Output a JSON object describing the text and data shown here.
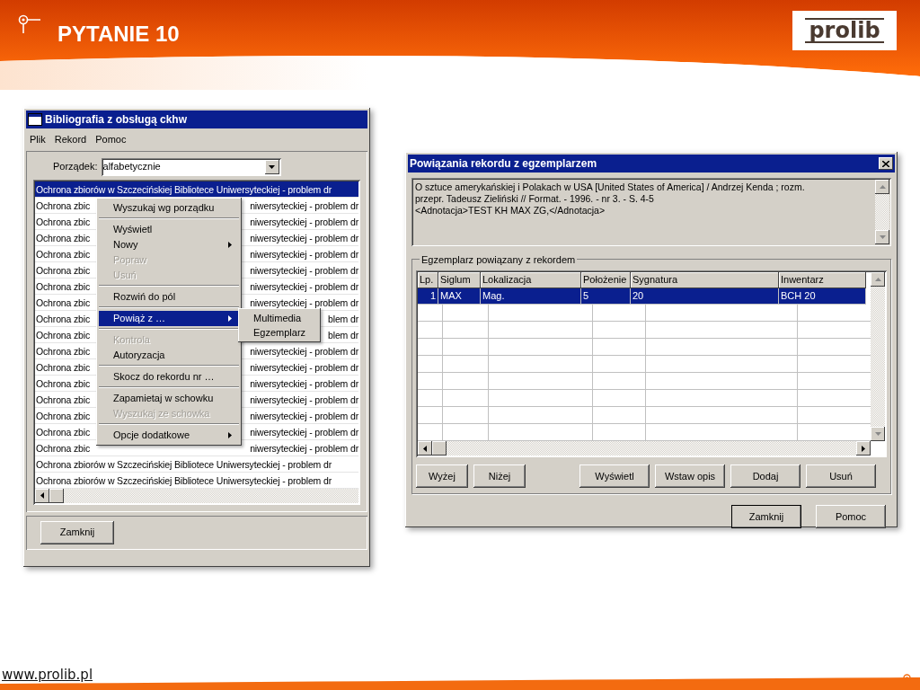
{
  "slide": {
    "title": "PYTANIE 10",
    "logo": "prolib",
    "footer_link": "www.prolib.pl"
  },
  "main_window": {
    "title": "Bibliografia z obsługą ckhw",
    "menu": [
      "Plik",
      "Rekord",
      "Pomoc"
    ],
    "order_label": "Porządek:",
    "order_value": "alfabetycznie",
    "close_button": "Zamknij",
    "rows": [
      {
        "kind": "full",
        "text": "Ochrona zbiorów w Szczecińskiej Bibliotece Uniwersyteckiej - problem dr",
        "selected": true
      },
      {
        "kind": "covered",
        "left": "Ochrona zbic",
        "right": "niwersyteckiej - problem dr",
        "selected": false
      },
      {
        "kind": "covered",
        "left": "Ochrona zbic",
        "right": "niwersyteckiej - problem dr",
        "selected": false
      },
      {
        "kind": "covered",
        "left": "Ochrona zbic",
        "right": "niwersyteckiej - problem dr",
        "selected": false
      },
      {
        "kind": "covered",
        "left": "Ochrona zbic",
        "right": "niwersyteckiej - problem dr",
        "selected": false
      },
      {
        "kind": "covered",
        "left": "Ochrona zbic",
        "right": "niwersyteckiej - problem dr",
        "selected": false
      },
      {
        "kind": "covered",
        "left": "Ochrona zbic",
        "right": "niwersyteckiej - problem dr",
        "selected": false
      },
      {
        "kind": "covered",
        "left": "Ochrona zbic",
        "right": "niwersyteckiej - problem dr",
        "selected": false
      },
      {
        "kind": "covered",
        "left": "Ochrona zbic",
        "right": "blem dr",
        "selected": false
      },
      {
        "kind": "covered",
        "left": "Ochrona zbic",
        "right": "blem dr",
        "selected": false
      },
      {
        "kind": "covered",
        "left": "Ochrona zbic",
        "right": "niwersyteckiej - problem dr",
        "selected": false
      },
      {
        "kind": "covered",
        "left": "Ochrona zbic",
        "right": "niwersyteckiej - problem dr",
        "selected": false
      },
      {
        "kind": "covered",
        "left": "Ochrona zbic",
        "right": "niwersyteckiej - problem dr",
        "selected": false
      },
      {
        "kind": "covered",
        "left": "Ochrona zbic",
        "right": "niwersyteckiej - problem dr",
        "selected": false
      },
      {
        "kind": "covered",
        "left": "Ochrona zbic",
        "right": "niwersyteckiej - problem dr",
        "selected": false
      },
      {
        "kind": "covered",
        "left": "Ochrona zbic",
        "right": "niwersyteckiej - problem dr",
        "selected": false
      },
      {
        "kind": "covered",
        "left": "Ochrona zbic",
        "right": "niwersyteckiej - problem dr",
        "selected": false
      },
      {
        "kind": "full",
        "text": "Ochrona zbiorów w Szczecińskiej Bibliotece Uniwersyteckiej - problem dr",
        "selected": false
      },
      {
        "kind": "full",
        "text": "Ochrona zbiorów w Szczecińskiej Bibliotece Uniwersyteckiej - problem dr",
        "selected": false
      }
    ]
  },
  "context_menu": {
    "items": [
      {
        "kind": "item",
        "label": "Wyszukaj wg porządku",
        "disabled": false,
        "submenu": false,
        "selected": false
      },
      {
        "kind": "separator"
      },
      {
        "kind": "item",
        "label": "Wyświetl",
        "disabled": false,
        "submenu": false,
        "selected": false
      },
      {
        "kind": "item",
        "label": "Nowy",
        "disabled": false,
        "submenu": true,
        "selected": false
      },
      {
        "kind": "item",
        "label": "Popraw",
        "disabled": true,
        "submenu": false,
        "selected": false
      },
      {
        "kind": "item",
        "label": "Usuń",
        "disabled": true,
        "submenu": false,
        "selected": false
      },
      {
        "kind": "separator"
      },
      {
        "kind": "item",
        "label": "Rozwiń do pól",
        "disabled": false,
        "submenu": false,
        "selected": false
      },
      {
        "kind": "separator"
      },
      {
        "kind": "item",
        "label": "Powiąż z …",
        "disabled": false,
        "submenu": true,
        "selected": true
      },
      {
        "kind": "separator"
      },
      {
        "kind": "item",
        "label": "Kontrola",
        "disabled": true,
        "submenu": false,
        "selected": false
      },
      {
        "kind": "item",
        "label": "Autoryzacja",
        "disabled": false,
        "submenu": false,
        "selected": false
      },
      {
        "kind": "separator"
      },
      {
        "kind": "item",
        "label": "Skocz do rekordu nr …",
        "disabled": false,
        "submenu": false,
        "selected": false
      },
      {
        "kind": "separator"
      },
      {
        "kind": "item",
        "label": "Zapamietaj w schowku",
        "disabled": false,
        "submenu": false,
        "selected": false
      },
      {
        "kind": "item",
        "label": "Wyszukaj ze schowka",
        "disabled": true,
        "submenu": false,
        "selected": false
      },
      {
        "kind": "separator"
      },
      {
        "kind": "item",
        "label": "Opcje dodatkowe",
        "disabled": false,
        "submenu": true,
        "selected": false
      }
    ]
  },
  "submenu": {
    "items": [
      "Multimedia",
      "Egzemplarz"
    ]
  },
  "dialog": {
    "title": "Powiązania rekordu z egzemplarzem",
    "description": [
      "O sztuce amerykańskiej i Polakach w USA [United States of America] / Andrzej Kenda ; rozm.",
      "przepr. Tadeusz Zieliński //  Format. - 1996. - nr 3. - S. 4-5",
      "<Adnotacja>TEST KH MAX ZG,</Adnotacja>"
    ],
    "group_label": "Egzemplarz powiązany z rekordem",
    "columns": [
      "Lp.",
      "Siglum",
      "Lokalizacja",
      "Położenie",
      "Sygnatura",
      "Inwentarz"
    ],
    "rows": [
      {
        "cells": [
          "1",
          "MAX",
          "Mag.",
          "5",
          "20",
          "BCH 20"
        ],
        "selected": true
      }
    ],
    "grid_buttons": [
      "Wyżej",
      "Niżej",
      "Wyświetl",
      "Wstaw opis",
      "Dodaj",
      "Usuń"
    ],
    "buttons": [
      "Zamknij",
      "Pomoc"
    ]
  }
}
